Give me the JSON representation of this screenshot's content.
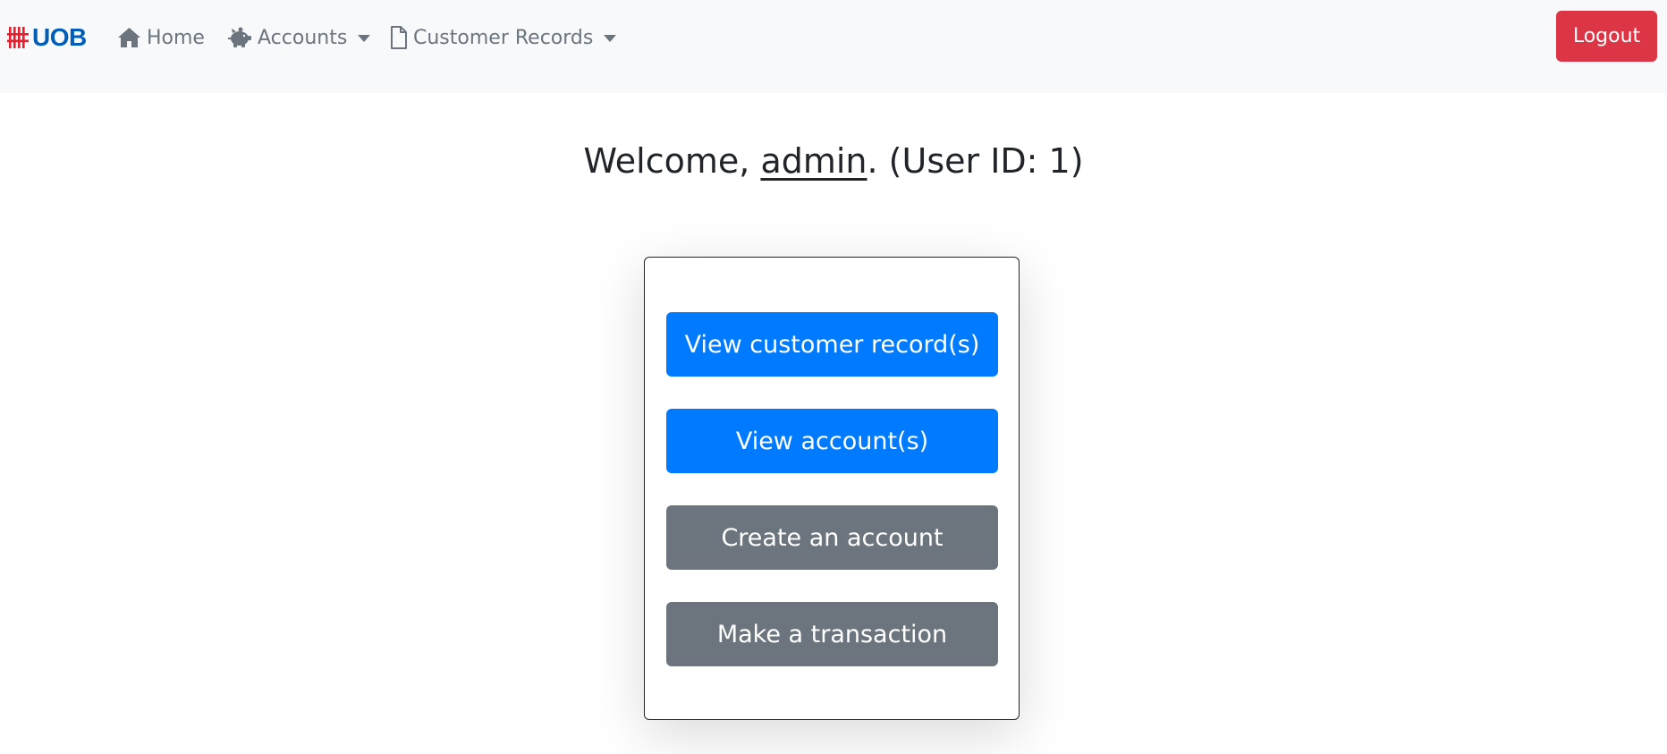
{
  "navbar": {
    "brand": {
      "text": "UOB",
      "icon": "uob-logo-icon",
      "logo_color": "#e4202e",
      "text_color": "#005eb8"
    },
    "items": [
      {
        "label": "Home",
        "icon": "home-icon",
        "dropdown": false
      },
      {
        "label": "Accounts",
        "icon": "piggy-bank-icon",
        "dropdown": true
      },
      {
        "label": "Customer Records",
        "icon": "file-icon",
        "dropdown": true
      }
    ],
    "logout_label": "Logout",
    "background": "#f8f9fa"
  },
  "welcome": {
    "prefix": "Welcome, ",
    "username": "admin",
    "suffix": ". (User ID: 1)"
  },
  "actions": [
    {
      "label": "View customer record(s)",
      "style": "primary"
    },
    {
      "label": "View account(s)",
      "style": "primary"
    },
    {
      "label": "Create an account",
      "style": "secondary"
    },
    {
      "label": "Make a transaction",
      "style": "secondary"
    }
  ],
  "colors": {
    "primary": "#007bff",
    "secondary": "#6c757d",
    "danger": "#dc3545"
  }
}
